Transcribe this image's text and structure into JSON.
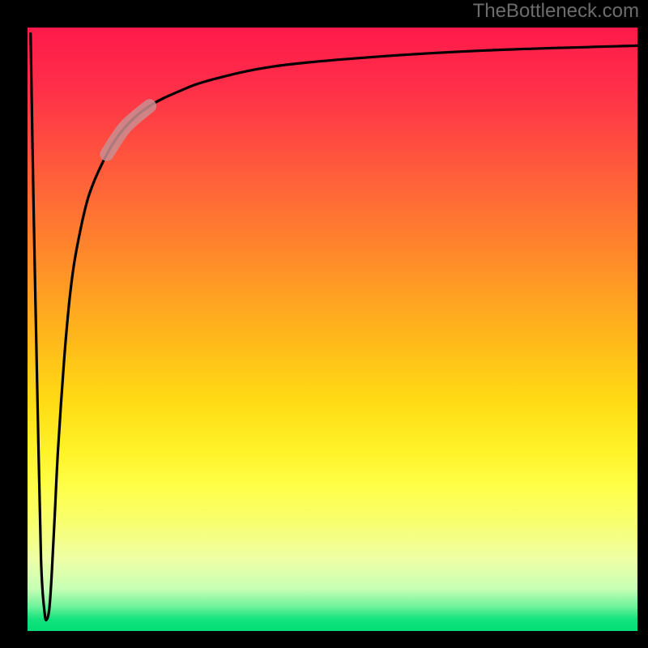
{
  "watermark": "TheBottleneck.com",
  "colors": {
    "frame": "#000000",
    "gradient_top": "#ff1a4b",
    "gradient_mid": "#ffe733",
    "gradient_bottom": "#00dd77",
    "curve": "#000000",
    "highlight": "#c98e90"
  },
  "chart_data": {
    "type": "line",
    "title": "",
    "xlabel": "",
    "ylabel": "",
    "xlim": [
      0,
      100
    ],
    "ylim": [
      0,
      100
    ],
    "series": [
      {
        "name": "bottleneck-curve",
        "x": [
          0.5,
          1.0,
          1.6,
          2.2,
          2.8,
          3.2,
          3.6,
          4.0,
          4.5,
          5,
          6,
          7,
          8,
          10,
          13,
          16,
          20,
          25,
          30,
          40,
          55,
          75,
          100
        ],
        "y": [
          99,
          70,
          40,
          12,
          3,
          2,
          4,
          10,
          20,
          30,
          45,
          56,
          63,
          72,
          79,
          83.5,
          87,
          89.5,
          91.3,
          93.5,
          95,
          96.2,
          97
        ]
      }
    ],
    "highlight_segment": {
      "series": "bottleneck-curve",
      "x_start": 13,
      "x_end": 20,
      "note": "pale thick overlay on the curve"
    },
    "grid": false,
    "legend": false
  }
}
